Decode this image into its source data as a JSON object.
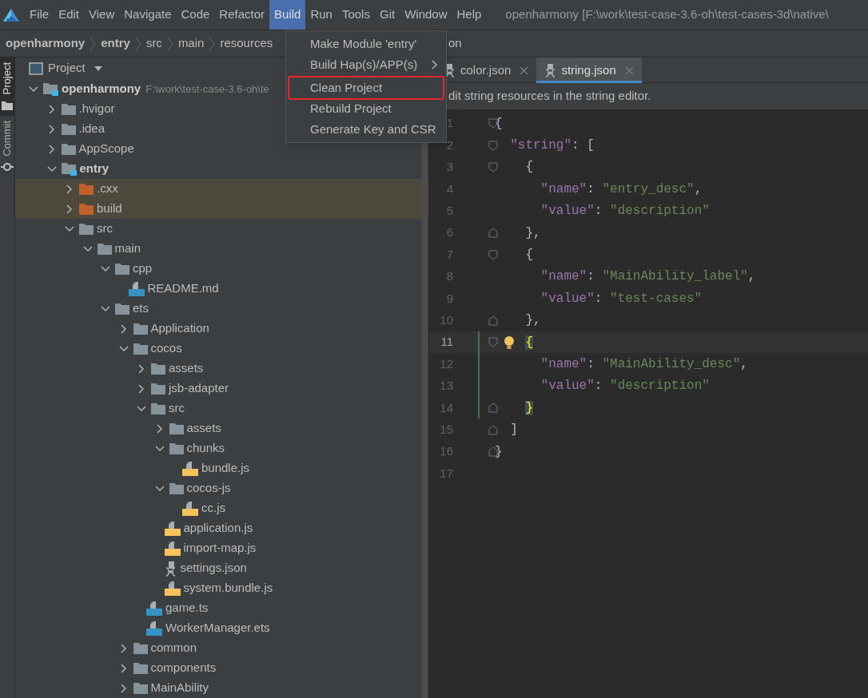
{
  "menu_bar": {
    "items": [
      {
        "label": "File",
        "selected": false
      },
      {
        "label": "Edit",
        "selected": false
      },
      {
        "label": "View",
        "selected": false
      },
      {
        "label": "Navigate",
        "selected": false
      },
      {
        "label": "Code",
        "selected": false
      },
      {
        "label": "Refactor",
        "selected": false
      },
      {
        "label": "Build",
        "selected": true
      },
      {
        "label": "Run",
        "selected": false
      },
      {
        "label": "Tools",
        "selected": false
      },
      {
        "label": "Git",
        "selected": false
      },
      {
        "label": "Window",
        "selected": false
      },
      {
        "label": "Help",
        "selected": false
      }
    ],
    "title": "openharmony [F:\\work\\test-case-3.6-oh\\test-cases-3d\\native\\"
  },
  "breadcrumb": [
    {
      "label": "openharmony",
      "bold": true
    },
    {
      "label": "entry",
      "bold": true
    },
    {
      "label": "src",
      "bold": false
    },
    {
      "label": "main",
      "bold": false
    },
    {
      "label": "resources",
      "bold": false
    }
  ],
  "breadcrumb_tail": "on",
  "tool_strip": [
    {
      "label": "Project",
      "selected": true
    },
    {
      "label": "Commit",
      "selected": false
    }
  ],
  "project_panel": {
    "title": "Project",
    "tree": [
      {
        "label": "openharmony",
        "kind": "module",
        "path": "F:\\work\\test-case-3.6-oh\\te",
        "expanded": true,
        "children": [
          {
            "label": ".hvigor",
            "kind": "folder",
            "expanded": false
          },
          {
            "label": ".idea",
            "kind": "folder",
            "expanded": false
          },
          {
            "label": "AppScope",
            "kind": "folder",
            "expanded": false
          },
          {
            "label": "entry",
            "kind": "module",
            "expanded": true,
            "children": [
              {
                "label": ".cxx",
                "kind": "excluded",
                "expanded": false
              },
              {
                "label": "build",
                "kind": "excluded",
                "expanded": false
              },
              {
                "label": "src",
                "kind": "folder",
                "expanded": true,
                "children": [
                  {
                    "label": "main",
                    "kind": "folder",
                    "expanded": true,
                    "children": [
                      {
                        "label": "cpp",
                        "kind": "folder",
                        "expanded": true,
                        "children": [
                          {
                            "label": "README.md",
                            "kind": "md"
                          }
                        ]
                      },
                      {
                        "label": "ets",
                        "kind": "folder",
                        "expanded": true,
                        "children": [
                          {
                            "label": "Application",
                            "kind": "folder",
                            "expanded": false
                          },
                          {
                            "label": "cocos",
                            "kind": "folder",
                            "expanded": true,
                            "children": [
                              {
                                "label": "assets",
                                "kind": "folder",
                                "expanded": false
                              },
                              {
                                "label": "jsb-adapter",
                                "kind": "folder",
                                "expanded": false
                              },
                              {
                                "label": "src",
                                "kind": "folder",
                                "expanded": true,
                                "children": [
                                  {
                                    "label": "assets",
                                    "kind": "folder",
                                    "expanded": false
                                  },
                                  {
                                    "label": "chunks",
                                    "kind": "folder",
                                    "expanded": true,
                                    "children": [
                                      {
                                        "label": "bundle.js",
                                        "kind": "js"
                                      }
                                    ]
                                  },
                                  {
                                    "label": "cocos-js",
                                    "kind": "folder",
                                    "expanded": true,
                                    "children": [
                                      {
                                        "label": "cc.js",
                                        "kind": "js"
                                      }
                                    ]
                                  },
                                  {
                                    "label": "application.js",
                                    "kind": "js"
                                  },
                                  {
                                    "label": "import-map.js",
                                    "kind": "js"
                                  },
                                  {
                                    "label": "settings.json",
                                    "kind": "json"
                                  },
                                  {
                                    "label": "system.bundle.js",
                                    "kind": "js"
                                  }
                                ]
                              },
                              {
                                "label": "game.ts",
                                "kind": "ts"
                              },
                              {
                                "label": "WorkerManager.ets",
                                "kind": "ets"
                              }
                            ]
                          },
                          {
                            "label": "common",
                            "kind": "folder",
                            "expanded": false
                          },
                          {
                            "label": "components",
                            "kind": "folder",
                            "expanded": false
                          },
                          {
                            "label": "MainAbility",
                            "kind": "folder",
                            "expanded": false
                          }
                        ]
                      }
                    ]
                  }
                ]
              }
            ]
          }
        ]
      }
    ]
  },
  "editor": {
    "tabs": [
      {
        "label": "color.json",
        "selected": false
      },
      {
        "label": "string.json",
        "selected": true
      }
    ],
    "notice": "dit string resources in the string editor.",
    "lines": [
      {
        "number": "1",
        "text": "{",
        "fold_start": true,
        "fold_end": false,
        "current": false,
        "changed": false,
        "brace_match": false,
        "bulb": false
      },
      {
        "number": "2",
        "text": "  \"string\": [",
        "fold_start": true,
        "fold_end": false,
        "current": false,
        "changed": false,
        "brace_match": false,
        "bulb": false
      },
      {
        "number": "3",
        "text": "    {",
        "fold_start": true,
        "fold_end": false,
        "current": false,
        "changed": false,
        "brace_match": false,
        "bulb": false
      },
      {
        "number": "4",
        "text": "      \"name\": \"entry_desc\",",
        "fold_start": false,
        "fold_end": false,
        "current": false,
        "changed": false,
        "brace_match": false,
        "bulb": false
      },
      {
        "number": "5",
        "text": "      \"value\": \"description\"",
        "fold_start": false,
        "fold_end": false,
        "current": false,
        "changed": false,
        "brace_match": false,
        "bulb": false
      },
      {
        "number": "6",
        "text": "    },",
        "fold_start": false,
        "fold_end": true,
        "current": false,
        "changed": false,
        "brace_match": false,
        "bulb": false
      },
      {
        "number": "7",
        "text": "    {",
        "fold_start": true,
        "fold_end": false,
        "current": false,
        "changed": false,
        "brace_match": false,
        "bulb": false
      },
      {
        "number": "8",
        "text": "      \"name\": \"MainAbility_label\",",
        "fold_start": false,
        "fold_end": false,
        "current": false,
        "changed": false,
        "brace_match": false,
        "bulb": false
      },
      {
        "number": "9",
        "text": "      \"value\": \"test-cases\"",
        "fold_start": false,
        "fold_end": false,
        "current": false,
        "changed": false,
        "brace_match": false,
        "bulb": false
      },
      {
        "number": "10",
        "text": "    },",
        "fold_start": false,
        "fold_end": true,
        "current": false,
        "changed": false,
        "brace_match": false,
        "bulb": false
      },
      {
        "number": "11",
        "text": "    {",
        "fold_start": true,
        "fold_end": false,
        "current": true,
        "changed": true,
        "brace_match": true,
        "bulb": true
      },
      {
        "number": "12",
        "text": "      \"name\": \"MainAbility_desc\",",
        "fold_start": false,
        "fold_end": false,
        "current": false,
        "changed": true,
        "brace_match": false,
        "bulb": false
      },
      {
        "number": "13",
        "text": "      \"value\": \"description\"",
        "fold_start": false,
        "fold_end": false,
        "current": false,
        "changed": true,
        "brace_match": false,
        "bulb": false
      },
      {
        "number": "14",
        "text": "    }",
        "fold_start": false,
        "fold_end": true,
        "current": false,
        "changed": true,
        "brace_match": true,
        "bulb": false
      },
      {
        "number": "15",
        "text": "  ]",
        "fold_start": false,
        "fold_end": true,
        "current": false,
        "changed": false,
        "brace_match": false,
        "bulb": false
      },
      {
        "number": "16",
        "text": "}",
        "fold_start": false,
        "fold_end": true,
        "current": false,
        "changed": false,
        "brace_match": false,
        "bulb": false
      },
      {
        "number": "17",
        "fold_start": false,
        "fold_end": false,
        "current": false,
        "changed": false,
        "brace_match": false,
        "bulb": false
      }
    ]
  },
  "build_menu": [
    {
      "label": "Make Module 'entry'",
      "submenu": false,
      "separator_before": false,
      "annotated": false
    },
    {
      "label": "Build Hap(s)/APP(s)",
      "submenu": true,
      "separator_before": false,
      "annotated": false
    },
    {
      "label": "Clean Project",
      "submenu": false,
      "separator_before": true,
      "annotated": true
    },
    {
      "label": "Rebuild Project",
      "submenu": false,
      "separator_before": false,
      "annotated": false
    },
    {
      "label": "Generate Key and CSR",
      "submenu": false,
      "separator_before": false,
      "annotated": false
    }
  ]
}
